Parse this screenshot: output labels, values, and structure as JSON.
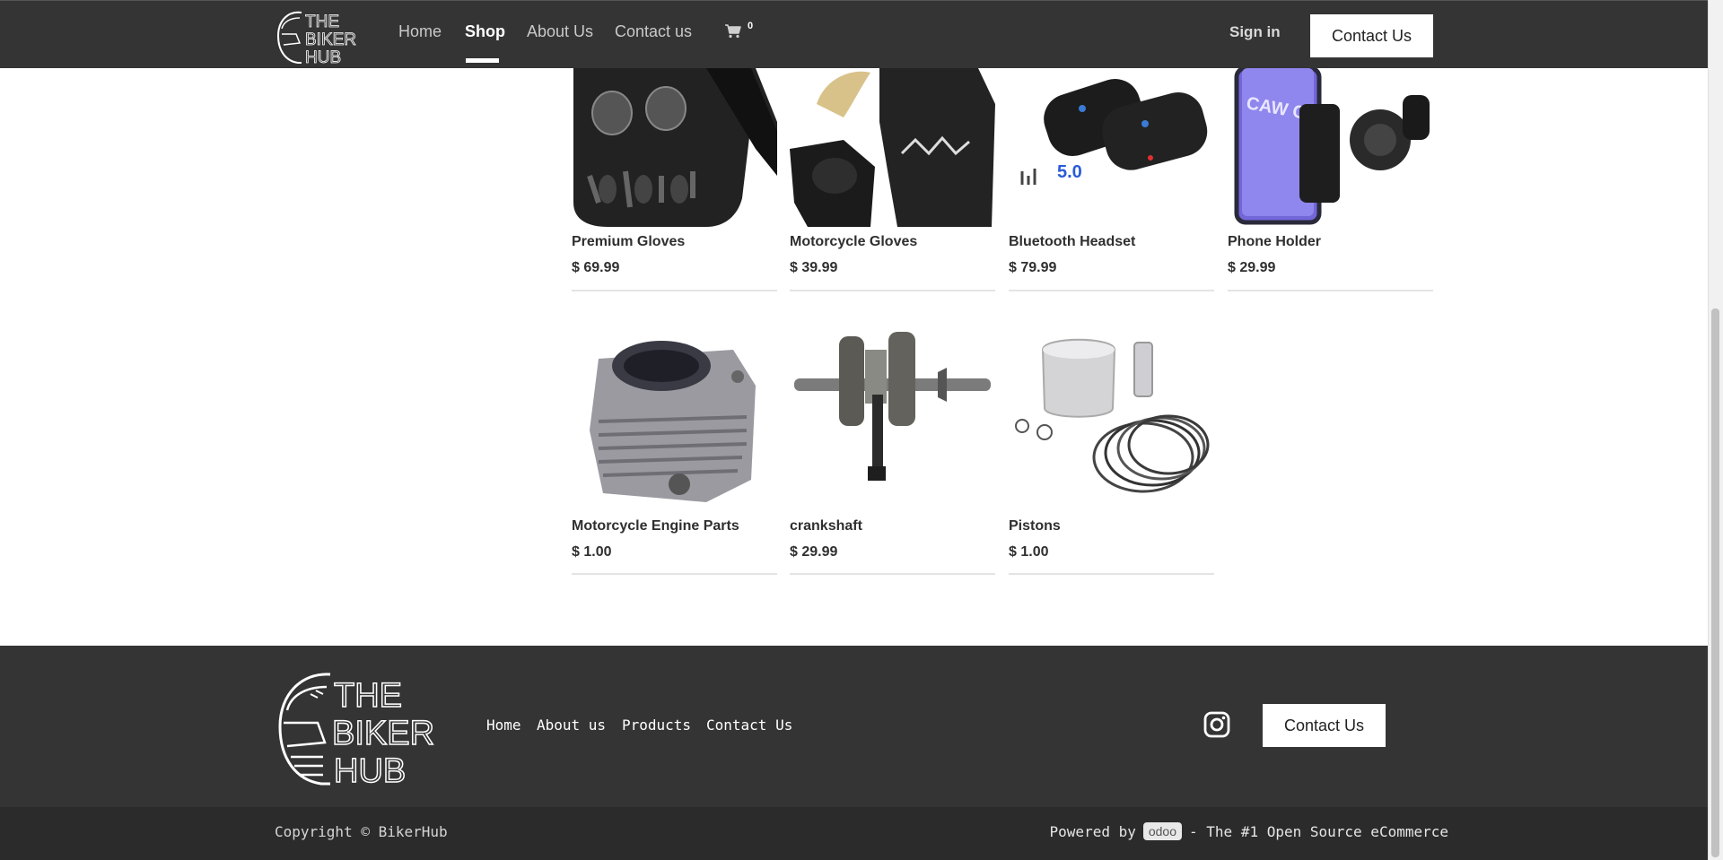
{
  "header": {
    "logo_text": [
      "THE",
      "BIKER",
      "HUB"
    ],
    "nav": [
      "Home",
      "Shop",
      "About Us",
      "Contact us"
    ],
    "active_nav": "Shop",
    "cart_count": "0",
    "sign_in": "Sign in",
    "contact_button": "Contact Us"
  },
  "products": [
    {
      "name": "Premium Gloves",
      "price": "$ 69.99",
      "icon": "black-leather-gloves-image"
    },
    {
      "name": "Motorcycle Gloves",
      "price": "$ 39.99",
      "icon": "motorcycle-gloves-image"
    },
    {
      "name": "Bluetooth Headset",
      "price": "$ 79.99",
      "icon": "bluetooth-headset-image"
    },
    {
      "name": "Phone Holder",
      "price": "$ 29.99",
      "icon": "phone-holder-image"
    },
    {
      "name": "Motorcycle Engine Parts",
      "price": "$ 1.00",
      "icon": "engine-cylinder-image"
    },
    {
      "name": "crankshaft",
      "price": "$ 29.99",
      "icon": "crankshaft-image"
    },
    {
      "name": "Pistons",
      "price": "$ 1.00",
      "icon": "piston-kit-image"
    }
  ],
  "product_image_text": {
    "headset_badge": "5.0",
    "phone_holder_brand": "CAW CAR"
  },
  "footer": {
    "links": [
      "Home",
      "About us",
      "Products",
      "Contact Us"
    ],
    "contact_button": "Contact Us",
    "social_icon": "instagram-icon",
    "copyright": "Copyright © BikerHub",
    "powered_by": "Powered by",
    "odoo": "odoo",
    "tagline": "- The #1 Open Source eCommerce"
  },
  "colors": {
    "header_bg": "#343435",
    "footer_bg": "#343435",
    "bottombar_bg": "#2b2b2c",
    "accent": "#ffffff"
  }
}
